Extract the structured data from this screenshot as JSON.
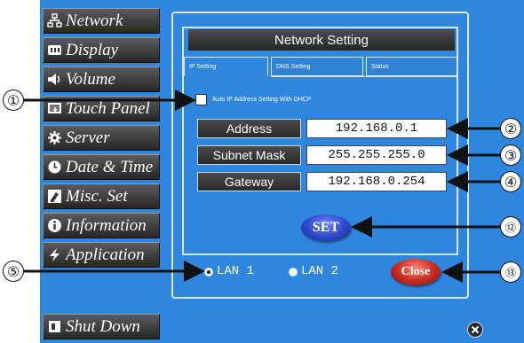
{
  "sidebar": {
    "items": [
      {
        "label": "Network",
        "icon": "network-icon"
      },
      {
        "label": "Display",
        "icon": "display-icon"
      },
      {
        "label": "Volume",
        "icon": "speaker-icon"
      },
      {
        "label": "Touch Panel",
        "icon": "touch-panel-icon"
      },
      {
        "label": "Server",
        "icon": "gear-icon"
      },
      {
        "label": "Date & Time",
        "icon": "clock-icon"
      },
      {
        "label": "Misc. Set",
        "icon": "misc-icon"
      },
      {
        "label": "Information",
        "icon": "info-icon"
      },
      {
        "label": "Application",
        "icon": "lightning-icon"
      }
    ],
    "shutdown": {
      "label": "Shut Down",
      "icon": "shutdown-icon"
    }
  },
  "panel": {
    "title": "Network Setting",
    "tabs": [
      "IP Setting",
      "DNS Setting",
      "Status"
    ],
    "active_tab": "IP Setting",
    "dhcp_label": "Auto IP Address Setting With DHCP",
    "dhcp_checked": false,
    "fields": [
      {
        "label": "Address",
        "value": "192.168.0.1"
      },
      {
        "label": "Subnet Mask",
        "value": "255.255.255.0"
      },
      {
        "label": "Gateway",
        "value": "192.168.0.254"
      }
    ],
    "set_label": "SET",
    "close_label": "Close",
    "lan_options": [
      "LAN 1",
      "LAN 2"
    ],
    "lan_selected": "LAN 1"
  },
  "callouts": {
    "dhcp": "①",
    "address": "②",
    "subnet": "③",
    "gateway": "④",
    "lan": "⑤",
    "set": "⑫",
    "close": "⑬"
  },
  "colors": {
    "background": "#2f86df",
    "button": "#333333",
    "set": "#2e49c9",
    "close": "#c42a20"
  }
}
